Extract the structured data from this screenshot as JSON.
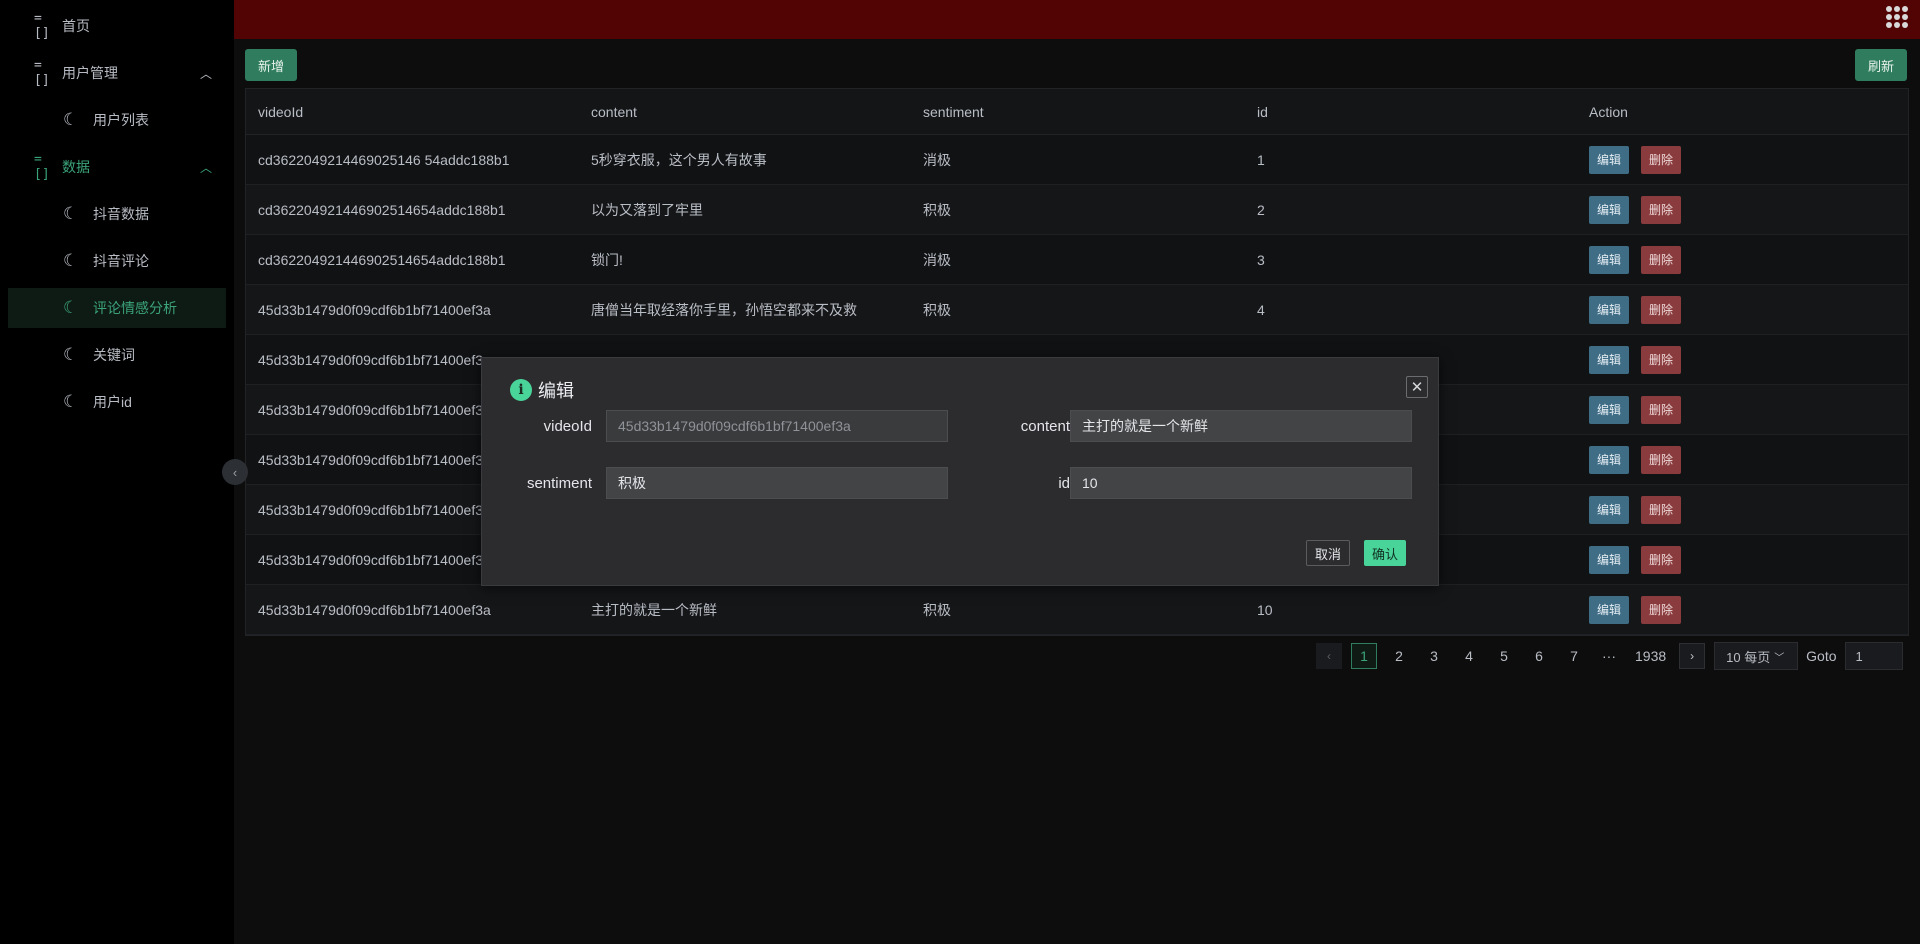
{
  "sidebar": {
    "items": [
      {
        "label": "首页",
        "icon": "menu-icon"
      },
      {
        "label": "用户管理",
        "icon": "menu-icon"
      },
      {
        "label": "用户列表",
        "icon": "moon-icon"
      },
      {
        "label": "数据",
        "icon": "menu-icon"
      },
      {
        "label": "抖音数据",
        "icon": "moon-icon"
      },
      {
        "label": "抖音评论",
        "icon": "moon-icon"
      },
      {
        "label": "评论情感分析",
        "icon": "moon-icon"
      },
      {
        "label": "关键词",
        "icon": "moon-icon"
      },
      {
        "label": "用户id",
        "icon": "moon-icon"
      }
    ],
    "accent": "#3ba37a"
  },
  "topbar": {
    "color": "#520304"
  },
  "toolbar": {
    "add_label": "新增",
    "refresh_label": "刷新"
  },
  "table": {
    "headers": [
      "videoId",
      "content",
      "sentiment",
      "id",
      "Action"
    ],
    "edit_label": "编辑",
    "delete_label": "删除",
    "rows": [
      [
        "cd3622049214469025146 54addc188b1",
        "5秒穿衣服，这个男人有故事",
        "消极",
        "1"
      ],
      [
        "cd362204921446902514654addc188b1",
        "以为又落到了牢里",
        "积极",
        "2"
      ],
      [
        "cd362204921446902514654addc188b1",
        "锁门!",
        "消极",
        "3"
      ],
      [
        "45d33b1479d0f09cdf6b1bf71400ef3a",
        "唐僧当年取经落你手里，孙悟空都来不及救",
        "积极",
        "4"
      ],
      [
        "45d33b1479d0f09cdf6b1bf71400ef3a",
        "",
        "",
        ""
      ],
      [
        "45d33b1479d0f09cdf6b1bf71400ef3a",
        "",
        "",
        ""
      ],
      [
        "45d33b1479d0f09cdf6b1bf71400ef3a",
        "",
        "",
        ""
      ],
      [
        "45d33b1479d0f09cdf6b1bf71400ef3a",
        "",
        "",
        ""
      ],
      [
        "45d33b1479d0f09cdf6b1bf71400ef3a",
        "",
        "",
        ""
      ],
      [
        "45d33b1479d0f09cdf6b1bf71400ef3a",
        "主打的就是一个新鲜",
        "积极",
        "10"
      ]
    ]
  },
  "pagination": {
    "pages": [
      "1",
      "2",
      "3",
      "4",
      "5",
      "6",
      "7",
      "···",
      "1938"
    ],
    "current": "1",
    "page_size": "10 每页",
    "goto_label": "Goto",
    "goto_value": "1"
  },
  "modal": {
    "title": "编辑",
    "fields": {
      "videoId": {
        "label": "videoId",
        "value": "45d33b1479d0f09cdf6b1bf71400ef3a"
      },
      "content": {
        "label": "content",
        "value": "主打的就是一个新鲜"
      },
      "sentiment": {
        "label": "sentiment",
        "value": "积极"
      },
      "id": {
        "label": "id",
        "value": "10"
      }
    },
    "cancel_label": "取消",
    "confirm_label": "确认"
  }
}
